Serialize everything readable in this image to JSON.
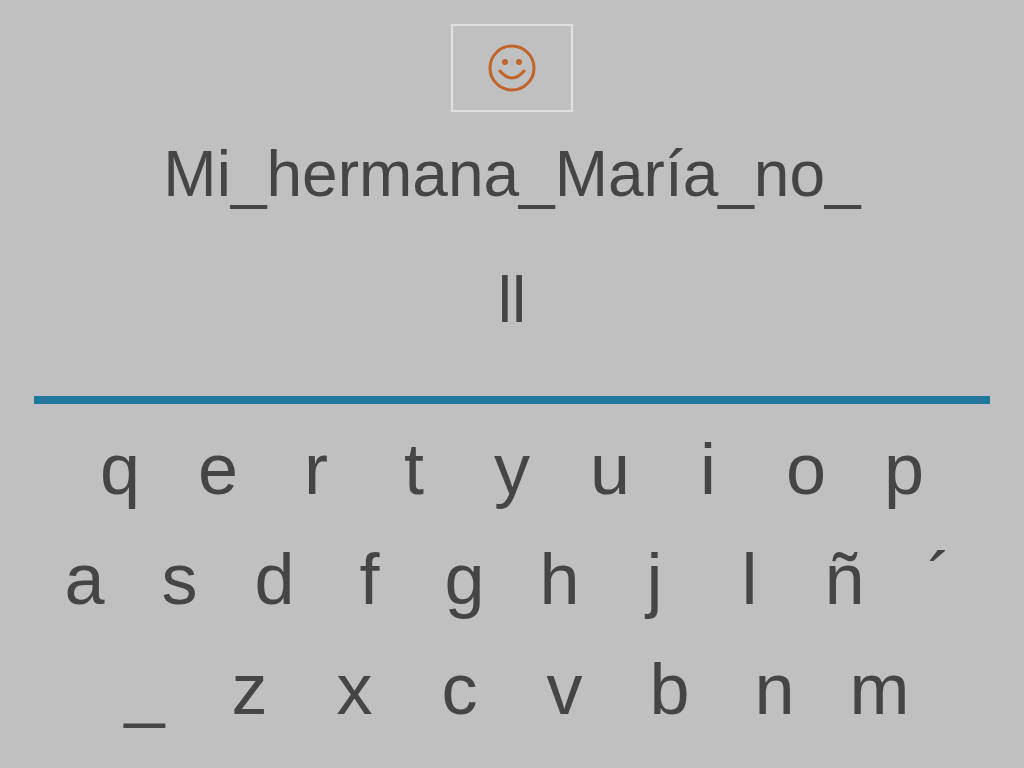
{
  "feedback": {
    "kind": "smiley"
  },
  "sentence": "Mi_hermana_María_no_",
  "answer": "ll",
  "keyboard": [
    [
      "q",
      "e",
      "r",
      "t",
      "y",
      "u",
      "i",
      "o",
      "p"
    ],
    [
      "a",
      "s",
      "d",
      "f",
      "g",
      "h",
      "j",
      "l",
      "ñ",
      "´"
    ],
    [
      "_",
      "z",
      "x",
      "c",
      "v",
      "b",
      "n",
      "m"
    ]
  ]
}
